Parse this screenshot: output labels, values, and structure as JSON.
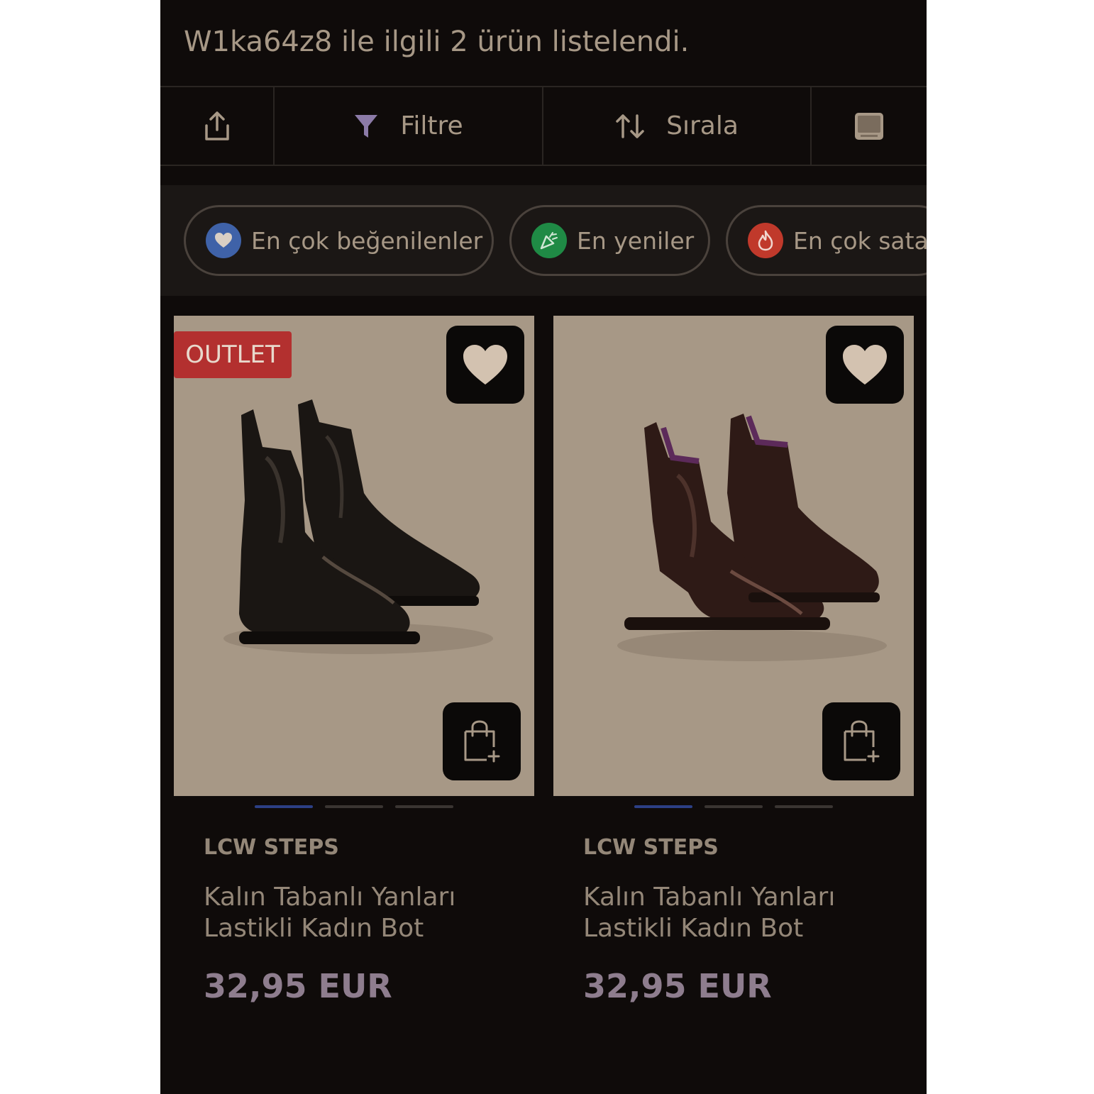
{
  "header": {
    "result_text": "W1ka64z8 ile ilgili 2 ürün listelendi."
  },
  "toolbar": {
    "share_icon": "share-icon",
    "filter_label": "Filtre",
    "filter_icon": "funnel-icon",
    "sort_label": "Sırala",
    "sort_icon": "sort-arrows-icon",
    "view_icon": "grid-view-icon"
  },
  "chips": [
    {
      "label": "En çok beğenilenler",
      "icon": "heart-icon",
      "color": "#3f62a8"
    },
    {
      "label": "En yeniler",
      "icon": "confetti-icon",
      "color": "#1f8a45"
    },
    {
      "label": "En çok satanlar",
      "icon": "flame-icon",
      "color": "#c0392b"
    }
  ],
  "products": [
    {
      "badge": "OUTLET",
      "brand": "LCW STEPS",
      "title": "Kalın Tabanlı Yanları Lastikli Kadın Bot",
      "price": "32,95 EUR",
      "boot_color": "#1a1613",
      "image_count": 3,
      "active_image": 1
    },
    {
      "badge": "",
      "brand": "LCW STEPS",
      "title": "Kalın Tabanlı Yanları Lastikli Kadın Bot",
      "price": "32,95 EUR",
      "boot_color": "#2e1a16",
      "image_count": 3,
      "active_image": 1
    }
  ],
  "colors": {
    "background": "#0f0b0a",
    "image_bg": "#a79886",
    "outlet_red": "#b3302f",
    "price": "#8e7d8e",
    "active_dot": "#2c3f85"
  }
}
